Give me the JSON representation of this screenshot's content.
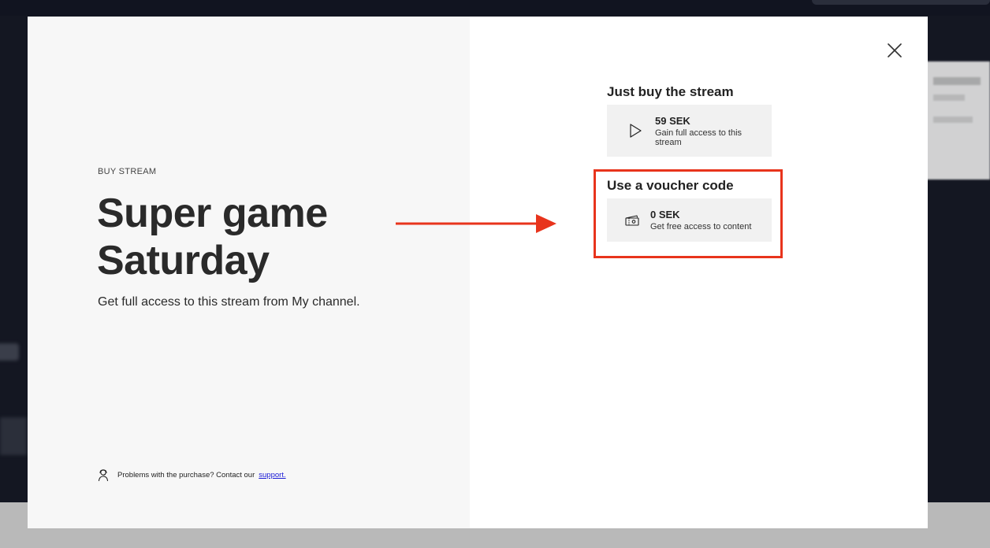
{
  "modal": {
    "eyebrow": "BUY STREAM",
    "title": "Super game Saturday",
    "subtitle": "Get full access to this stream from My channel.",
    "support": {
      "text": "Problems with the purchase? Contact our",
      "link_label": "support.",
      "icon": "support-agent-icon"
    },
    "close_icon": "close-icon"
  },
  "offers": {
    "buy": {
      "section_title": "Just buy the stream",
      "price": "59 SEK",
      "description": "Gain full access to this stream",
      "icon": "play-icon"
    },
    "voucher": {
      "section_title": "Use a voucher code",
      "price": "0 SEK",
      "description": "Get free access to content",
      "icon": "ticket-icon"
    }
  },
  "annotation": {
    "highlight_color": "#e8341c",
    "arrow_color": "#e8341c"
  },
  "colors": {
    "left_panel_bg": "#f7f7f7",
    "offer_bg": "#f1f1f1",
    "text": "#2a2a2a",
    "link": "#1a1ad6"
  }
}
